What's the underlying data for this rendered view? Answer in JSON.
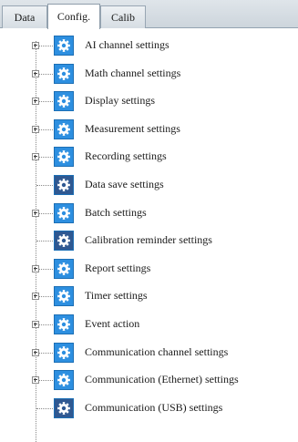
{
  "tabs": [
    {
      "label": "Data"
    },
    {
      "label": "Config."
    },
    {
      "label": "Calib"
    }
  ],
  "tree": {
    "items": [
      {
        "label": "AI channel settings",
        "expandable": true,
        "icon": "gear-icon",
        "icon_color": "#2d8fe0"
      },
      {
        "label": "Math channel settings",
        "expandable": true,
        "icon": "gear-icon",
        "icon_color": "#2d8fe0"
      },
      {
        "label": "Display settings",
        "expandable": true,
        "icon": "gear-icon",
        "icon_color": "#2d8fe0"
      },
      {
        "label": "Measurement settings",
        "expandable": true,
        "icon": "gear-icon",
        "icon_color": "#2d8fe0"
      },
      {
        "label": "Recording settings",
        "expandable": true,
        "icon": "gear-icon",
        "icon_color": "#2d8fe0"
      },
      {
        "label": "Data save settings",
        "expandable": false,
        "icon": "gear-icon",
        "icon_color": "#2f5891"
      },
      {
        "label": "Batch settings",
        "expandable": true,
        "icon": "gear-icon",
        "icon_color": "#2d8fe0"
      },
      {
        "label": "Calibration reminder settings",
        "expandable": false,
        "icon": "gear-icon",
        "icon_color": "#2f5891"
      },
      {
        "label": "Report settings",
        "expandable": true,
        "icon": "gear-icon",
        "icon_color": "#2d8fe0"
      },
      {
        "label": "Timer settings",
        "expandable": true,
        "icon": "gear-icon",
        "icon_color": "#2d8fe0"
      },
      {
        "label": "Event action",
        "expandable": true,
        "icon": "gear-icon",
        "icon_color": "#2d8fe0"
      },
      {
        "label": "Communication channel settings",
        "expandable": true,
        "icon": "gear-icon",
        "icon_color": "#2d8fe0"
      },
      {
        "label": "Communication (Ethernet) settings",
        "expandable": true,
        "icon": "gear-icon",
        "icon_color": "#2d8fe0"
      },
      {
        "label": "Communication (USB) settings",
        "expandable": false,
        "icon": "gear-icon",
        "icon_color": "#2f5891"
      }
    ]
  }
}
